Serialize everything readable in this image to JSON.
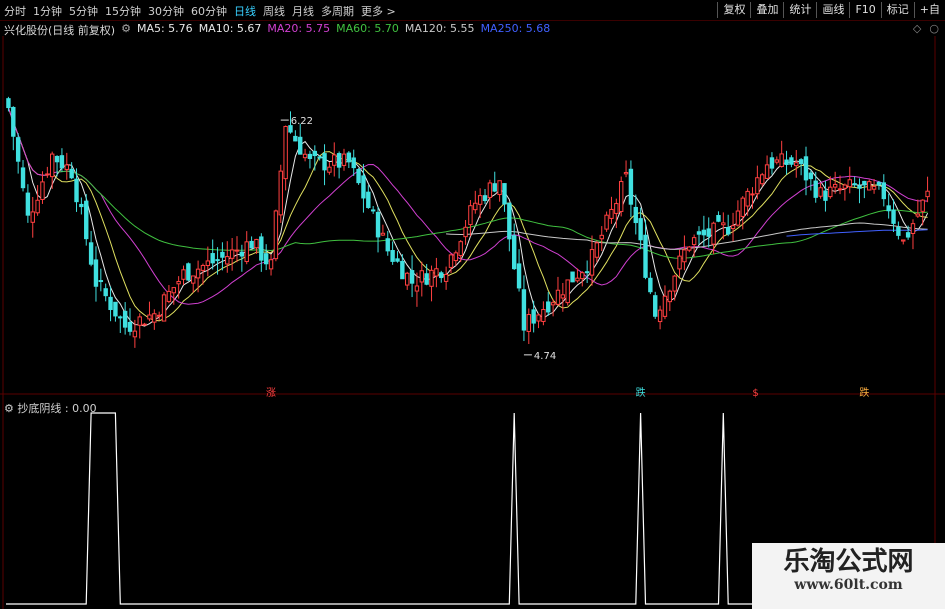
{
  "toolbar": {
    "period_tabs": [
      "分时",
      "1分钟",
      "5分钟",
      "15分钟",
      "30分钟",
      "60分钟",
      "日线",
      "周线",
      "月线",
      "多周期",
      "更多 >"
    ],
    "active_tab": "日线",
    "buttons": [
      "复权",
      "叠加",
      "统计",
      "画线",
      "F10",
      "标记",
      "+自"
    ]
  },
  "main_header": {
    "stock_title": "兴化股份(日线 前复权)",
    "settings_icon": "gear-icon",
    "ma_items": [
      {
        "label": "MA5: 5.76",
        "color": "#e8e8e8"
      },
      {
        "label": "MA10: 5.67",
        "color": "#e8e8e8"
      },
      {
        "label": "MA20: 5.75",
        "color": "#d040d0"
      },
      {
        "label": "MA60: 5.70",
        "color": "#40c040"
      },
      {
        "label": "MA120: 5.55",
        "color": "#c8c8c8"
      },
      {
        "label": "MA250: 5.68",
        "color": "#4060ff"
      }
    ]
  },
  "indicator_header": {
    "title": "抄底阴线 : 0.00"
  },
  "colors": {
    "up": "#ff4040",
    "down": "#40e0e0",
    "ma5": "#e8e8e8",
    "ma10": "#e0e060",
    "ma20": "#d040d0",
    "ma60": "#40c040",
    "ma120": "#c8c8c8",
    "ma250": "#4060ff",
    "indicator": "#ffffff"
  },
  "chart_data": [
    {
      "type": "candlestick",
      "title": "兴化股份(日线 前复权)",
      "ylim": [
        4.55,
        6.75
      ],
      "annotations": [
        {
          "label": "6.22",
          "x_index": 56,
          "y": 6.22
        },
        {
          "label": "4.74",
          "x_index": 106,
          "y": 4.74
        }
      ],
      "signal_marks": [
        {
          "label": "涨",
          "x_index": 54,
          "color": "#ff4040"
        },
        {
          "label": "跌",
          "x_index": 130,
          "color": "#40e0e0"
        },
        {
          "label": "$",
          "x_index": 154,
          "color": "#ff4040"
        },
        {
          "label": "跌",
          "x_index": 176,
          "color": "#ffb040"
        }
      ]
    },
    {
      "type": "line",
      "title": "抄底阴线",
      "ylim": [
        0,
        1
      ],
      "pulses": [
        {
          "start_index": 17,
          "end_index": 23,
          "value": 1
        },
        {
          "start_index": 104,
          "end_index": 105,
          "value": 1
        },
        {
          "start_index": 130,
          "end_index": 131,
          "value": 1
        },
        {
          "start_index": 147,
          "end_index": 148,
          "value": 1
        }
      ]
    }
  ],
  "watermark": {
    "title": "乐淘公式网",
    "url": "www.60lt.com"
  }
}
